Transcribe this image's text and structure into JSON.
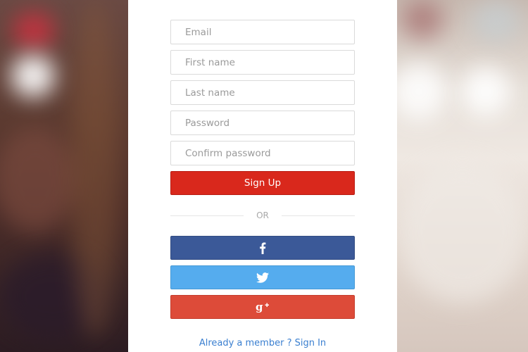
{
  "form": {
    "email_placeholder": "Email",
    "first_name_placeholder": "First name",
    "last_name_placeholder": "Last name",
    "password_placeholder": "Password",
    "confirm_password_placeholder": "Confirm password",
    "signup_label": "Sign Up",
    "divider_text": "OR"
  },
  "social": {
    "facebook_icon": "facebook-icon",
    "twitter_icon": "twitter-icon",
    "google_plus_icon": "google-plus-icon"
  },
  "footer": {
    "member_link": "Already a member ? Sign In"
  },
  "colors": {
    "signup": "#d9281c",
    "facebook": "#3b5998",
    "twitter": "#55acee",
    "google_plus": "#dd4b39",
    "link": "#3a7fd0"
  }
}
